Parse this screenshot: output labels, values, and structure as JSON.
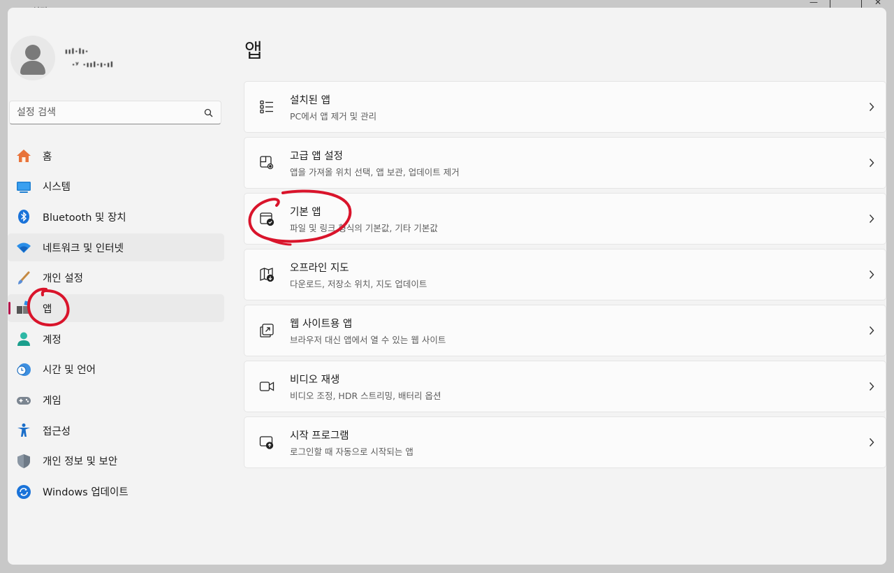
{
  "window": {
    "title": "설정"
  },
  "profile": {
    "name": "ııl·lı·",
    "email": "·ʸ ·ııl·ı·ıl"
  },
  "search": {
    "placeholder": "설정 검색"
  },
  "sidebar": {
    "items": [
      {
        "label": "홈",
        "icon": "home-icon"
      },
      {
        "label": "시스템",
        "icon": "system-icon"
      },
      {
        "label": "Bluetooth 및 장치",
        "icon": "bluetooth-icon"
      },
      {
        "label": "네트워크 및 인터넷",
        "icon": "network-icon"
      },
      {
        "label": "개인 설정",
        "icon": "brush-icon"
      },
      {
        "label": "앱",
        "icon": "apps-icon",
        "selected": true
      },
      {
        "label": "계정",
        "icon": "account-icon"
      },
      {
        "label": "시간 및 언어",
        "icon": "time-language-icon"
      },
      {
        "label": "게임",
        "icon": "gamepad-icon"
      },
      {
        "label": "접근성",
        "icon": "accessibility-icon"
      },
      {
        "label": "개인 정보 및 보안",
        "icon": "shield-icon"
      },
      {
        "label": "Windows 업데이트",
        "icon": "update-icon"
      }
    ]
  },
  "main": {
    "title": "앱",
    "cards": [
      {
        "title": "설치된 앱",
        "desc": "PC에서 앱 제거 및 관리",
        "icon": "installed-apps-icon"
      },
      {
        "title": "고급 앱 설정",
        "desc": "앱을 가져올 위치 선택, 앱 보관, 업데이트 제거",
        "icon": "advanced-apps-icon"
      },
      {
        "title": "기본 앱",
        "desc": "파일 및 링크 형식의 기본값, 기타 기본값",
        "icon": "default-apps-icon"
      },
      {
        "title": "오프라인 지도",
        "desc": "다운로드, 저장소 위치, 지도 업데이트",
        "icon": "offline-maps-icon"
      },
      {
        "title": "웹 사이트용 앱",
        "desc": "브라우저 대신 앱에서 열 수 있는 웹 사이트",
        "icon": "web-apps-icon"
      },
      {
        "title": "비디오 재생",
        "desc": "비디오 조정, HDR 스트리밍, 배터리 옵션",
        "icon": "video-icon"
      },
      {
        "title": "시작 프로그램",
        "desc": "로그인할 때 자동으로 시작되는 앱",
        "icon": "startup-icon"
      }
    ]
  },
  "colors": {
    "accent": "#b5124a",
    "annotation": "#d9142b",
    "window_bg": "#f3f3f3",
    "card_bg": "#fbfbfb"
  }
}
